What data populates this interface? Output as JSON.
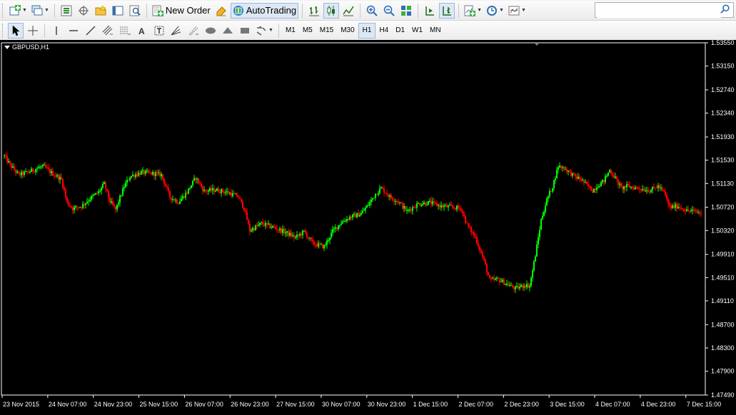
{
  "toolbar": {
    "new_order_label": "New Order",
    "autotrading_label": "AutoTrading",
    "search_placeholder": "",
    "icons": [
      "new-chart-icon",
      "profiles-icon",
      "market-watch-icon",
      "data-window-icon",
      "navigator-icon",
      "terminal-icon",
      "strategy-tester-icon",
      "new-order-icon",
      "metaeditor-icon",
      "autotrading-icon",
      "bar-chart-icon",
      "candlesticks-icon",
      "line-chart-icon",
      "zoom-in-icon",
      "zoom-out-icon",
      "tile-windows-icon",
      "auto-scroll-icon",
      "chart-shift-icon",
      "indicators-icon",
      "periods-icon",
      "templates-icon"
    ]
  },
  "drawing_toolbar": {
    "tools": [
      "cursor",
      "crosshair",
      "vertical-line",
      "horizontal-line",
      "trendline",
      "equidistant-channel",
      "fibonacci-retracement",
      "text",
      "text-label",
      "gann-fan",
      "fibonacci-fan",
      "ellipse",
      "triangle",
      "rectangle",
      "arrows"
    ],
    "timeframes": [
      "M1",
      "M5",
      "M15",
      "M30",
      "H1",
      "H4",
      "D1",
      "W1",
      "MN"
    ],
    "active_timeframe": "H1"
  },
  "chart": {
    "title": "GBPUSD,H1",
    "background": "#000000",
    "bull_color": "#00ff00",
    "bear_color": "#ff0000",
    "axis_color": "#ffffff"
  },
  "chart_data": {
    "type": "candlestick",
    "symbol": "GBPUSD",
    "timeframe": "H1",
    "ylim": [
      1.4749,
      1.5355
    ],
    "y_ticks": [
      "1.53550",
      "1.53150",
      "1.52740",
      "1.52340",
      "1.51930",
      "1.51530",
      "1.51130",
      "1.50720",
      "1.50320",
      "1.49910",
      "1.49510",
      "1.49110",
      "1.48700",
      "1.48300",
      "1.47900",
      "1.47490"
    ],
    "x_ticks": [
      "23 Nov 2015",
      "24 Nov 07:00",
      "24 Nov 23:00",
      "25 Nov 15:00",
      "26 Nov 07:00",
      "26 Nov 23:00",
      "27 Nov 15:00",
      "30 Nov 07:00",
      "30 Nov 23:00",
      "1 Dec 15:00",
      "2 Dec 07:00",
      "2 Dec 23:00",
      "3 Dec 15:00",
      "4 Dec 07:00",
      "4 Dec 23:00",
      "7 Dec 15:00"
    ],
    "close_path": [
      [
        0,
        1.516
      ],
      [
        4,
        1.5145
      ],
      [
        10,
        1.5128
      ],
      [
        16,
        1.5132
      ],
      [
        24,
        1.514
      ],
      [
        28,
        1.5142
      ],
      [
        32,
        1.5133
      ],
      [
        40,
        1.512
      ],
      [
        44,
        1.508
      ],
      [
        48,
        1.507
      ],
      [
        54,
        1.5074
      ],
      [
        60,
        1.5087
      ],
      [
        66,
        1.5098
      ],
      [
        70,
        1.5112
      ],
      [
        74,
        1.5082
      ],
      [
        78,
        1.5068
      ],
      [
        84,
        1.5108
      ],
      [
        88,
        1.5125
      ],
      [
        96,
        1.5132
      ],
      [
        104,
        1.513
      ],
      [
        110,
        1.5128
      ],
      [
        116,
        1.509
      ],
      [
        122,
        1.5081
      ],
      [
        128,
        1.5098
      ],
      [
        134,
        1.5123
      ],
      [
        140,
        1.51
      ],
      [
        148,
        1.5102
      ],
      [
        156,
        1.5098
      ],
      [
        164,
        1.509
      ],
      [
        168,
        1.507
      ],
      [
        172,
        1.5032
      ],
      [
        180,
        1.5044
      ],
      [
        188,
        1.5038
      ],
      [
        196,
        1.503
      ],
      [
        204,
        1.502
      ],
      [
        210,
        1.503
      ],
      [
        216,
        1.501
      ],
      [
        224,
        1.5004
      ],
      [
        230,
        1.5031
      ],
      [
        236,
        1.5046
      ],
      [
        242,
        1.5055
      ],
      [
        250,
        1.5061
      ],
      [
        256,
        1.508
      ],
      [
        260,
        1.5095
      ],
      [
        264,
        1.5105
      ],
      [
        270,
        1.509
      ],
      [
        276,
        1.5082
      ],
      [
        282,
        1.5065
      ],
      [
        290,
        1.5078
      ],
      [
        298,
        1.508
      ],
      [
        306,
        1.5074
      ],
      [
        314,
        1.5072
      ],
      [
        320,
        1.507
      ],
      [
        324,
        1.5042
      ],
      [
        330,
        1.502
      ],
      [
        336,
        1.498
      ],
      [
        340,
        1.4946
      ],
      [
        346,
        1.4948
      ],
      [
        352,
        1.494
      ],
      [
        358,
        1.4932
      ],
      [
        364,
        1.4938
      ],
      [
        368,
        1.4937
      ],
      [
        372,
        1.499
      ],
      [
        376,
        1.505
      ],
      [
        380,
        1.5085
      ],
      [
        384,
        1.5108
      ],
      [
        388,
        1.5143
      ],
      [
        392,
        1.514
      ],
      [
        396,
        1.5132
      ],
      [
        400,
        1.5124
      ],
      [
        404,
        1.512
      ],
      [
        408,
        1.511
      ],
      [
        412,
        1.5101
      ],
      [
        416,
        1.511
      ],
      [
        420,
        1.5118
      ],
      [
        424,
        1.5136
      ],
      [
        428,
        1.5122
      ],
      [
        432,
        1.5105
      ],
      [
        436,
        1.5108
      ],
      [
        444,
        1.5105
      ],
      [
        452,
        1.5101
      ],
      [
        458,
        1.5108
      ],
      [
        462,
        1.5098
      ],
      [
        466,
        1.5072
      ],
      [
        472,
        1.5074
      ],
      [
        478,
        1.5066
      ],
      [
        484,
        1.5065
      ],
      [
        488,
        1.5062
      ]
    ]
  }
}
